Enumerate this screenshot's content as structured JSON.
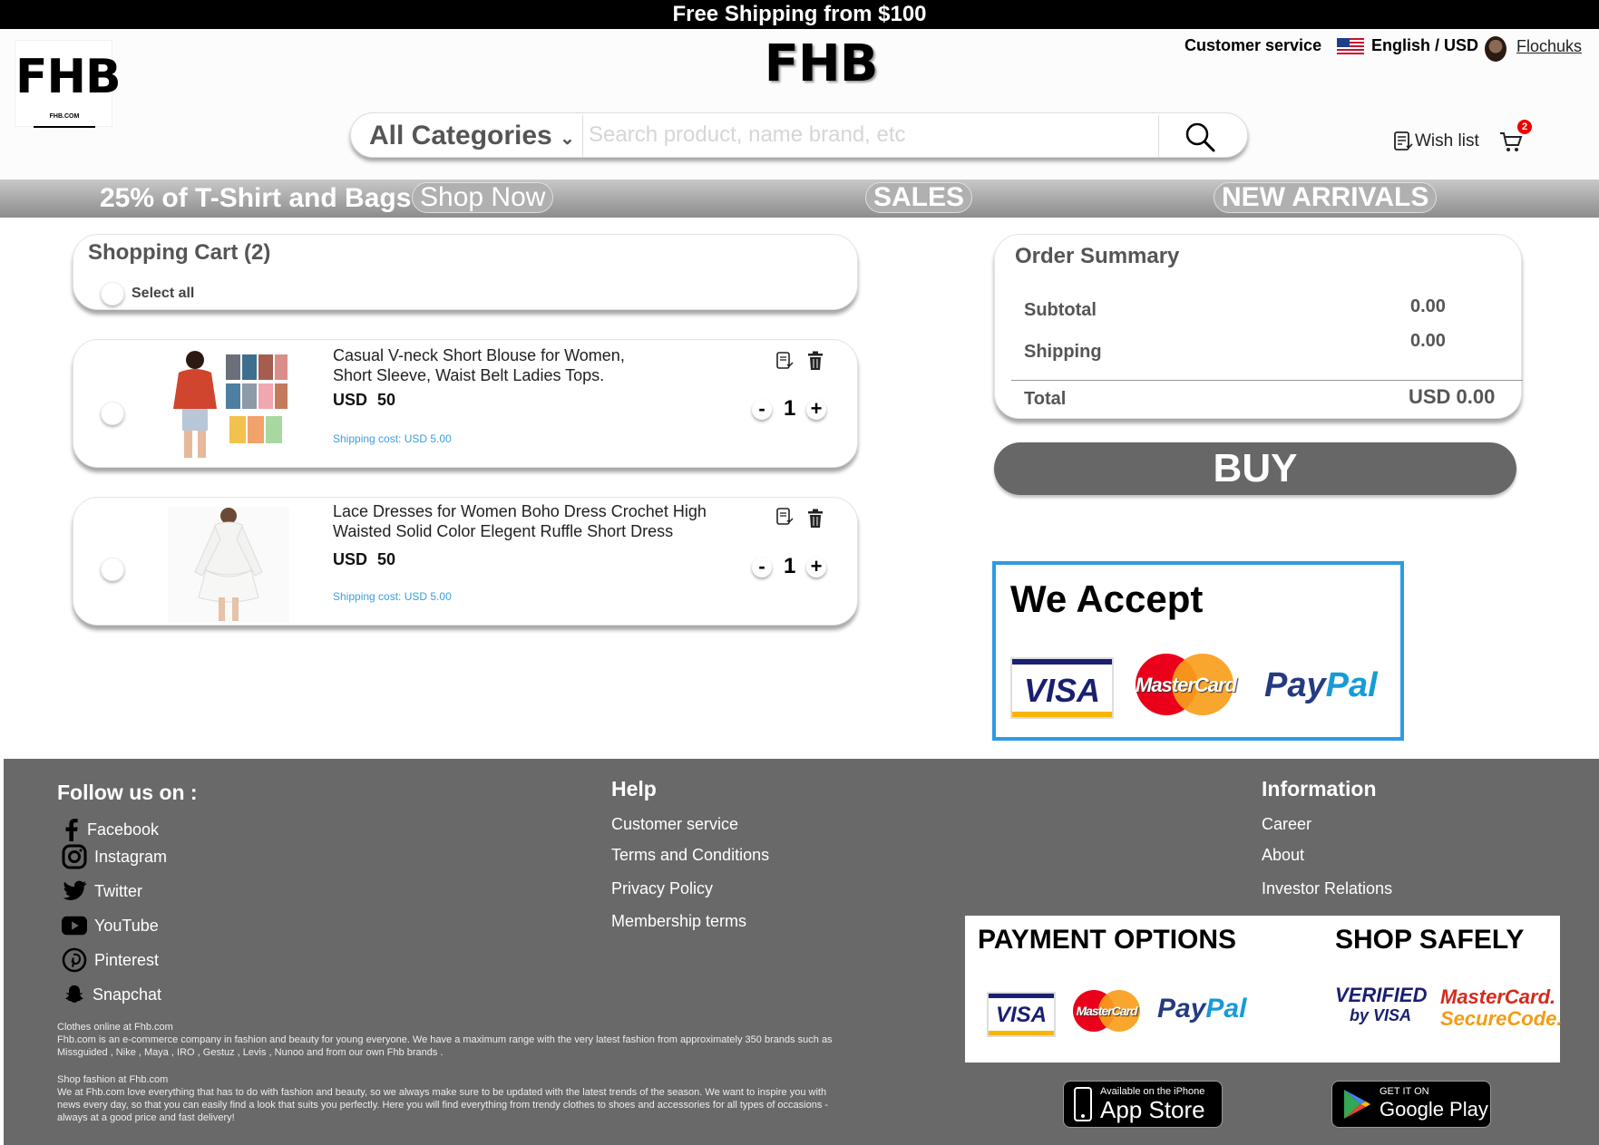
{
  "topbar": {
    "text": "Free Shipping from $100"
  },
  "header": {
    "logo": "FHB",
    "logo_small": "FHB.COM",
    "center_logo": "FHB",
    "customer_service": "Customer service",
    "language": "English / USD",
    "username": "Flochuks",
    "category": "All Categories",
    "search_placeholder": "Search product, name brand, etc",
    "wishlist": "Wish list",
    "cart_count": "2"
  },
  "promo": {
    "text": "25% of T-Shirt and Bags",
    "shop_now": "Shop Now",
    "sales": "SALES",
    "new_arrivals": "NEW ARRIVALS"
  },
  "cart": {
    "title": "Shopping Cart (2)",
    "select_all": "Select all",
    "items": [
      {
        "name_line1": "Casual V-neck Short Blouse for Women,",
        "name_line2": "Short Sleeve, Waist Belt Ladies Tops.",
        "price": "USD 50",
        "qty": "1",
        "shipping": "Shipping cost: USD 5.00"
      },
      {
        "name_line1": "Lace Dresses for Women Boho Dress Crochet High",
        "name_line2": "Waisted Solid Color Elegent Ruffle Short Dress",
        "price": "USD 50",
        "qty": "1",
        "shipping": "Shipping cost: USD 5.00"
      }
    ],
    "minus": "-",
    "plus": "+"
  },
  "order_summary": {
    "title": "Order Summary",
    "subtotal_label": "Subtotal",
    "subtotal_value": "0.00",
    "shipping_label": "Shipping",
    "shipping_value": "0.00",
    "total_label": "Total",
    "total_value": "USD 0.00",
    "buy": "BUY"
  },
  "we_accept": {
    "title": "We Accept",
    "visa": "VISA",
    "mastercard": "MasterCard",
    "paypal_1": "Pay",
    "paypal_2": "Pal"
  },
  "footer": {
    "follow_title": "Follow us on :",
    "socials": [
      "Facebook",
      "Instagram",
      "Twitter",
      "YouTube",
      "Pinterest",
      "Snapchat"
    ],
    "help_title": "Help",
    "help_links": [
      "Customer service",
      "Terms and Conditions",
      "Privacy Policy",
      "Membership terms"
    ],
    "info_title": "Information",
    "info_links": [
      "Career",
      "About",
      "Investor Relations"
    ],
    "about_1_title": "Clothes online at Fhb.com",
    "about_1_line1": "Fhb.com is an e-commerce company in fashion and beauty for young everyone. We have a maximum range with the very latest fashion from approximately 350 brands such as",
    "about_1_line2": "Missguided , Nike , Maya , IRO , Gestuz , Levis , Nunoo and from our own Fhb brands .",
    "about_2_title": "Shop fashion at Fhb.com",
    "about_2_line1": "We at Fhb.com love everything that has to do with fashion and beauty, so we always make sure to be updated with the latest trends of the season. We want to inspire you with",
    "about_2_line2": "news every day, so that you can easily find a look that suits you perfectly. Here you will find everything from trendy clothes to shoes and accessories for all types of occasions -",
    "about_2_line3": "always at a good price and fast delivery!",
    "payment_options": "PAYMENT OPTIONS",
    "shop_safely": "SHOP SAFELY",
    "verified_1": "VERIFIED",
    "verified_2": "by VISA",
    "securecode_1": "MasterCard.",
    "securecode_2": "SecureCode.",
    "appstore_small": "Available on the iPhone",
    "appstore_large": "App Store",
    "gplay_small": "GET IT ON",
    "gplay_large": "Google Play"
  }
}
